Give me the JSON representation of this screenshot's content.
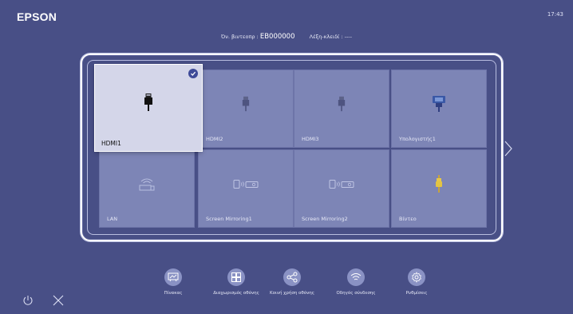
{
  "header": {
    "logo": "EPSON",
    "clock": "17:43",
    "projector_name_label": "Όν. βιντεοπρ :",
    "projector_name": "EB000000",
    "keyword_label": "Λέξη-κλειδί :",
    "keyword": "----"
  },
  "sources": [
    {
      "label": "HDMI1",
      "icon": "hdmi-icon",
      "selected": true
    },
    {
      "label": "HDMI2",
      "icon": "hdmi-icon"
    },
    {
      "label": "HDMI3",
      "icon": "hdmi-icon"
    },
    {
      "label": "Υπολογιστής1",
      "icon": "vga-connector-icon"
    },
    {
      "label": "LAN",
      "icon": "lan-icon"
    },
    {
      "label": "Screen Mirroring1",
      "icon": "screen-mirroring-icon"
    },
    {
      "label": "Screen Mirroring2",
      "icon": "screen-mirroring-icon"
    },
    {
      "label": "Βίντεο",
      "icon": "rca-video-icon"
    }
  ],
  "dock": [
    {
      "label": "Πίνακας",
      "icon": "whiteboard-icon"
    },
    {
      "label": "Διαχωρισμός οθόνης",
      "icon": "split-screen-icon"
    },
    {
      "label": "Κοινή χρήση οθόνης",
      "icon": "share-icon"
    },
    {
      "label": "Οδηγός σύνδεσης",
      "icon": "wireless-icon"
    },
    {
      "label": "Ρυθμίσεις",
      "icon": "gear-icon"
    }
  ],
  "colors": {
    "background": "#484f86",
    "tile": "#7d85b6",
    "selected_tile": "#d4d6e9",
    "check": "#3e4a98"
  }
}
